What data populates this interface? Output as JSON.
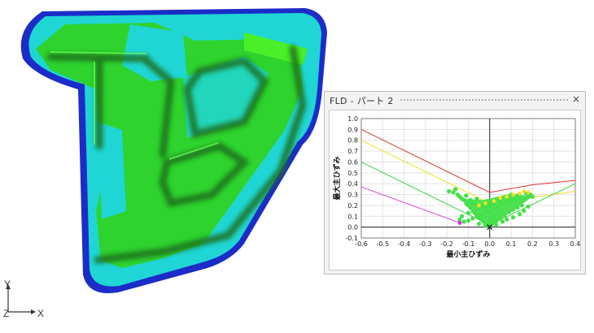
{
  "panel": {
    "title": "FLD - パート 2",
    "close_glyph": "×"
  },
  "triad": {
    "y_label": "Y",
    "z_label": "Z",
    "x_label": "X"
  },
  "chart_data": {
    "type": "scatter",
    "title": "",
    "xlabel": "最小主ひずみ",
    "ylabel": "最大主ひずみ",
    "xlim": [
      -0.6,
      0.4
    ],
    "ylim": [
      -0.1,
      1.0
    ],
    "xticks": [
      "-0.6",
      "-0.5",
      "-0.4",
      "-0.3",
      "-0.2",
      "-0.1",
      "0.0",
      "0.1",
      "0.2",
      "0.3",
      "0.4"
    ],
    "yticks": [
      "1.0",
      "0.9",
      "0.8",
      "0.7",
      "0.6",
      "0.5",
      "0.4",
      "0.3",
      "0.2",
      "0.1",
      "0.0",
      "-0.1"
    ],
    "grid": true,
    "colors": {
      "red": "#e83030",
      "yellow": "#f0e020",
      "green": "#39d13e",
      "magenta": "#d23fd2",
      "points": "#44e04a"
    },
    "lines": [
      {
        "color": "red",
        "x": [
          -0.6,
          0.0,
          0.2,
          0.4
        ],
        "y": [
          0.9,
          0.32,
          0.39,
          0.43
        ]
      },
      {
        "color": "yellow",
        "x": [
          -0.6,
          0.0,
          0.4
        ],
        "y": [
          0.8,
          0.22,
          0.33
        ]
      },
      {
        "color": "green",
        "x": [
          -0.6,
          0.0,
          0.4
        ],
        "y": [
          0.6,
          0.02,
          0.4
        ]
      },
      {
        "color": "magenta",
        "x": [
          -0.6,
          -0.14
        ],
        "y": [
          0.37,
          0.04
        ]
      }
    ],
    "scatter_points": [
      [
        -0.19,
        0.33
      ],
      [
        -0.17,
        0.32
      ],
      [
        -0.15,
        0.3
      ],
      [
        -0.14,
        0.28
      ],
      [
        -0.13,
        0.26
      ],
      [
        -0.12,
        0.25
      ],
      [
        -0.11,
        0.22
      ],
      [
        -0.1,
        0.2
      ],
      [
        -0.09,
        0.18
      ],
      [
        -0.08,
        0.15
      ],
      [
        -0.07,
        0.13
      ],
      [
        -0.06,
        0.11
      ],
      [
        -0.05,
        0.09
      ],
      [
        -0.04,
        0.07
      ],
      [
        -0.03,
        0.05
      ],
      [
        -0.02,
        0.03
      ],
      [
        -0.01,
        0.02
      ],
      [
        0.0,
        0.01
      ],
      [
        -0.12,
        0.05
      ],
      [
        -0.1,
        0.06
      ],
      [
        -0.08,
        0.08
      ],
      [
        -0.06,
        0.1
      ],
      [
        -0.04,
        0.12
      ],
      [
        -0.02,
        0.14
      ],
      [
        0.0,
        0.15
      ],
      [
        0.02,
        0.17
      ],
      [
        0.04,
        0.19
      ],
      [
        0.06,
        0.21
      ],
      [
        0.08,
        0.23
      ],
      [
        0.1,
        0.24
      ],
      [
        0.12,
        0.25
      ],
      [
        0.14,
        0.26
      ],
      [
        0.16,
        0.27
      ],
      [
        0.18,
        0.28
      ],
      [
        -0.14,
        0.07
      ],
      [
        -0.13,
        0.1
      ],
      [
        -0.03,
        0.2
      ],
      [
        0.01,
        0.21
      ],
      [
        0.05,
        0.24
      ],
      [
        0.09,
        0.27
      ],
      [
        0.13,
        0.29
      ],
      [
        0.17,
        0.31
      ],
      [
        0.01,
        0.03
      ],
      [
        0.03,
        0.05
      ],
      [
        0.05,
        0.08
      ],
      [
        0.07,
        0.11
      ],
      [
        0.09,
        0.14
      ],
      [
        0.11,
        0.16
      ],
      [
        0.13,
        0.18
      ],
      [
        0.15,
        0.2
      ],
      [
        0.02,
        0.1
      ],
      [
        0.04,
        0.13
      ],
      [
        -0.05,
        0.17
      ],
      [
        -0.07,
        0.21
      ],
      [
        0.19,
        0.3
      ],
      [
        0.2,
        0.28
      ],
      [
        0.1,
        0.3
      ],
      [
        0.06,
        0.27
      ],
      [
        0.02,
        0.24
      ],
      [
        -0.01,
        0.22
      ],
      [
        -0.09,
        0.25
      ],
      [
        -0.11,
        0.29
      ],
      [
        -0.16,
        0.35
      ],
      [
        -0.05,
        0.03
      ],
      [
        -0.02,
        0.01
      ],
      [
        0.03,
        0.02
      ],
      [
        0.06,
        0.05
      ],
      [
        0.08,
        0.07
      ],
      [
        0.11,
        0.09
      ],
      [
        0.14,
        0.12
      ],
      [
        0.16,
        0.15
      ],
      [
        0.18,
        0.19
      ],
      [
        -0.1,
        0.13
      ],
      [
        -0.08,
        0.22
      ],
      [
        -0.06,
        0.26
      ],
      [
        -0.02,
        0.19
      ],
      [
        0.0,
        0.07
      ],
      [
        0.02,
        0.08
      ]
    ],
    "yellow_points": [
      [
        0.02,
        0.24
      ],
      [
        0.05,
        0.27
      ],
      [
        0.08,
        0.28
      ],
      [
        0.11,
        0.3
      ],
      [
        0.14,
        0.31
      ],
      [
        -0.02,
        0.22
      ],
      [
        -0.05,
        0.2
      ],
      [
        0.16,
        0.33
      ],
      [
        0.18,
        0.32
      ]
    ],
    "magenta_points": [
      [
        -0.14,
        0.04
      ]
    ],
    "marker_points": [
      [
        0.0,
        0.0
      ]
    ]
  }
}
